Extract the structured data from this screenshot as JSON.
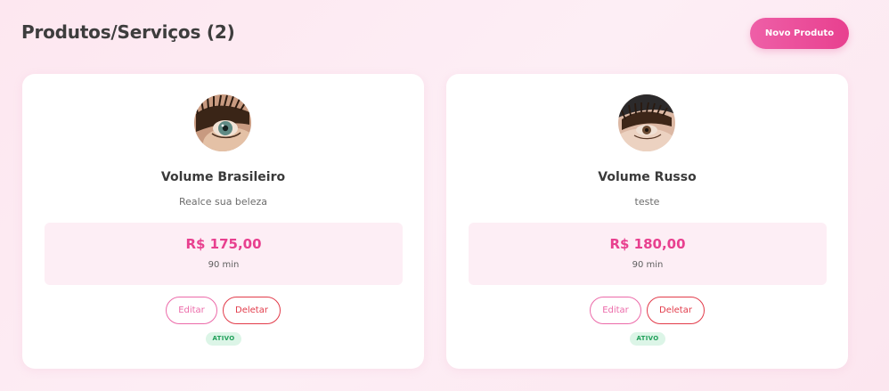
{
  "header": {
    "title": "Produtos/Serviços (2)",
    "new_button_label": "Novo Produto"
  },
  "products": [
    {
      "name": "Volume Brasileiro",
      "description": "Realce sua beleza",
      "price": "R$ 175,00",
      "duration": "90 min",
      "edit_label": "Editar",
      "delete_label": "Deletar",
      "status": "ATIVO"
    },
    {
      "name": "Volume Russo",
      "description": "teste",
      "price": "R$ 180,00",
      "duration": "90 min",
      "edit_label": "Editar",
      "delete_label": "Deletar",
      "status": "ATIVO"
    }
  ],
  "colors": {
    "accent": "#e8408f",
    "delete": "#e23b4a",
    "status_active": "#21a05a",
    "background": "#fdeef5"
  }
}
